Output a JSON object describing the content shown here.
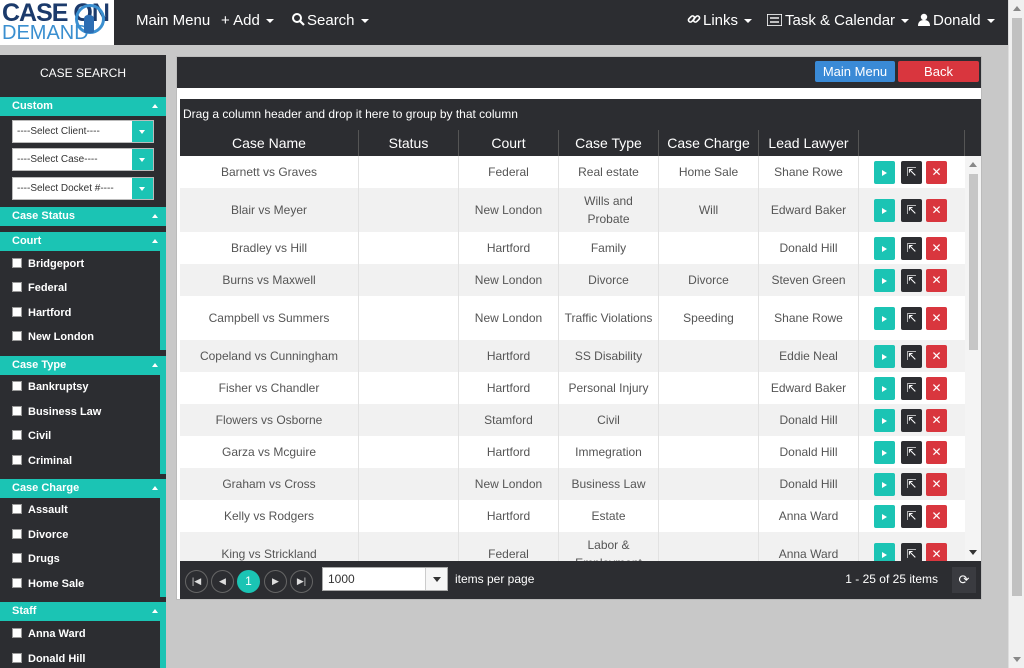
{
  "app": {
    "logo_line1": "CASE ON",
    "logo_line2": "DEMAND"
  },
  "nav": {
    "main_menu": "Main Menu",
    "add": "+ Add",
    "search": "Search",
    "links": "Links",
    "task_calendar": "Task & Calendar",
    "user": "Donald"
  },
  "sidebar": {
    "title": "CASE SEARCH",
    "custom": {
      "label": "Custom",
      "client_select": "----Select Client----",
      "case_select": "----Select Case----",
      "docket_select": "----Select Docket #----"
    },
    "case_status": {
      "label": "Case Status"
    },
    "court": {
      "label": "Court",
      "items": [
        "Bridgeport",
        "Federal",
        "Hartford",
        "New London"
      ]
    },
    "case_type": {
      "label": "Case Type",
      "items": [
        "Bankruptsy",
        "Business Law",
        "Civil",
        "Criminal"
      ]
    },
    "case_charge": {
      "label": "Case Charge",
      "items": [
        "Assault",
        "Divorce",
        "Drugs",
        "Home Sale"
      ]
    },
    "staff": {
      "label": "Staff",
      "items": [
        "Anna Ward",
        "Donald Hill"
      ]
    }
  },
  "panel": {
    "main_menu_btn": "Main Menu",
    "back_btn": "Back",
    "group_hint": "Drag a column header and drop it here to group by that column"
  },
  "table": {
    "headers": [
      "Case Name",
      "Status",
      "Court",
      "Case Type",
      "Case Charge",
      "Lead Lawyer"
    ],
    "rows": [
      {
        "name": "Barnett vs Graves",
        "status": "",
        "court": "Federal",
        "type": "Real estate",
        "charge": "Home Sale",
        "lawyer": "Shane Rowe"
      },
      {
        "name": "Blair vs Meyer",
        "status": "",
        "court": "New London",
        "type": "Wills and Probate",
        "charge": "Will",
        "lawyer": "Edward Baker"
      },
      {
        "name": "Bradley vs Hill",
        "status": "",
        "court": "Hartford",
        "type": "Family",
        "charge": "",
        "lawyer": "Donald Hill"
      },
      {
        "name": "Burns vs Maxwell",
        "status": "",
        "court": "New London",
        "type": "Divorce",
        "charge": "Divorce",
        "lawyer": "Steven Green"
      },
      {
        "name": "Campbell vs Summers",
        "status": "",
        "court": "New London",
        "type": "Traffic Violations",
        "charge": "Speeding",
        "lawyer": "Shane Rowe"
      },
      {
        "name": "Copeland vs Cunningham",
        "status": "",
        "court": "Hartford",
        "type": "SS Disability",
        "charge": "",
        "lawyer": "Eddie Neal"
      },
      {
        "name": "Fisher vs Chandler",
        "status": "",
        "court": "Hartford",
        "type": "Personal Injury",
        "charge": "",
        "lawyer": "Edward Baker"
      },
      {
        "name": "Flowers vs Osborne",
        "status": "",
        "court": "Stamford",
        "type": "Civil",
        "charge": "",
        "lawyer": "Donald Hill"
      },
      {
        "name": "Garza vs Mcguire",
        "status": "",
        "court": "Hartford",
        "type": "Immegration",
        "charge": "",
        "lawyer": "Donald Hill"
      },
      {
        "name": "Graham vs Cross",
        "status": "",
        "court": "New London",
        "type": "Business Law",
        "charge": "",
        "lawyer": "Donald Hill"
      },
      {
        "name": "Kelly vs Rodgers",
        "status": "",
        "court": "Hartford",
        "type": "Estate",
        "charge": "",
        "lawyer": "Anna Ward"
      },
      {
        "name": "King vs Strickland",
        "status": "",
        "court": "Federal",
        "type": "Labor & Employment",
        "charge": "",
        "lawyer": "Anna Ward"
      }
    ]
  },
  "pager": {
    "current_page": "1",
    "page_size": "1000",
    "per_page_label": "items per page",
    "info": "1 - 25 of 25 items"
  },
  "colors": {
    "accent": "#1bc4b4",
    "dark": "#2c2d31",
    "primary": "#3a8ad6",
    "danger": "#d9363e"
  }
}
